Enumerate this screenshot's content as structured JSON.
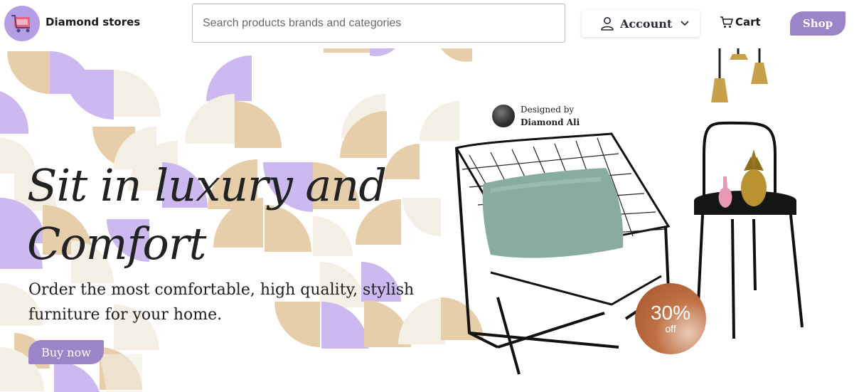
{
  "header": {
    "brand": "Diamond stores",
    "search_placeholder": "Search products brands and categories",
    "account_label": "Account",
    "cart_label": "Cart",
    "shop_label": "Shop"
  },
  "hero": {
    "headline_line1": "Sit in luxury and",
    "headline_line2": "Comfort",
    "subline_line1": "Order the most comfortable, high quality, stylish",
    "subline_line2": "furniture for your home.",
    "buy_label": "Buy now",
    "designer_caption": "Designed by",
    "designer_name": "Diamond Ali",
    "discount_value": "30%",
    "discount_suffix": "off"
  },
  "colors": {
    "accent": "#9b84c8",
    "lavender": "#cbb9f0",
    "tan": "#e7ceaa",
    "cream": "#f4efe4",
    "discount": "#a85530"
  },
  "icons": {
    "logo": "shopping-cart-logo-icon",
    "account": "user-icon",
    "account_caret": "chevron-down-icon",
    "cart": "cart-icon"
  }
}
